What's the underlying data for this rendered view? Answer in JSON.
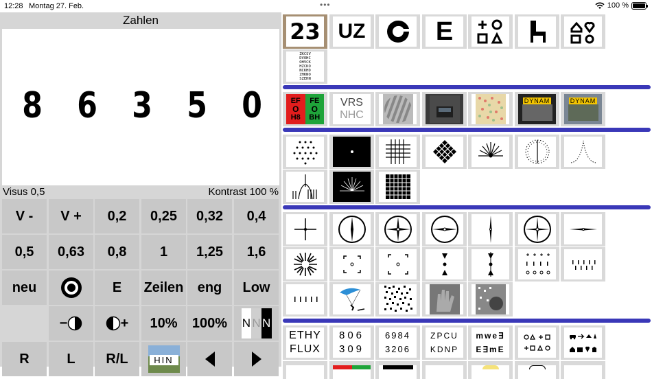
{
  "status": {
    "time": "12:28",
    "date": "Montag 27. Feb.",
    "battery": "100 %"
  },
  "panel": {
    "title": "Zahlen",
    "digits": [
      "8",
      "6",
      "3",
      "5",
      "0"
    ],
    "visus_label": "Visus  0,5",
    "kontrast_label": "Kontrast  100 %"
  },
  "buttons": {
    "row1": [
      "V -",
      "V +",
      "0,2",
      "0,25",
      "0,32",
      "0,4"
    ],
    "row2": [
      "0,5",
      "0,63",
      "0,8",
      "1",
      "1,25",
      "1,6"
    ],
    "row3": [
      "neu",
      "",
      "E",
      "Zeilen",
      "eng",
      "Low"
    ],
    "row4": [
      "",
      "",
      "",
      "10%",
      "100%",
      ""
    ],
    "row5": [
      "R",
      "L",
      "R/L",
      "",
      "",
      ""
    ],
    "hin_label": "HIN",
    "nnn": [
      "N",
      "N",
      "N"
    ]
  },
  "tiles": {
    "t_23": "23",
    "t_uz": "UZ",
    "t_e": "E",
    "t_vrs": "VRS",
    "t_nhc": "NHC",
    "t_ef_top": "EF",
    "t_fe_top": "FE",
    "t_ef_bot": "H8",
    "t_fe_bot": "BH",
    "t_dynam": "DYNAM",
    "t_eth": "ETHY",
    "t_flu": "FLUX",
    "t_806": "806",
    "t_309": "309",
    "t_6984": "6984",
    "t_3206": "3206",
    "t_zpcu": "ZPCU",
    "t_kdnp": "KDNP",
    "t_mwe": "mwe∃",
    "t_eme": "E∃mE",
    "t_chart": "ZKCSV\nDVOHC\nOHVCK\nHZCKO\nNCKHD\nZHKNO\nSZEHN"
  }
}
